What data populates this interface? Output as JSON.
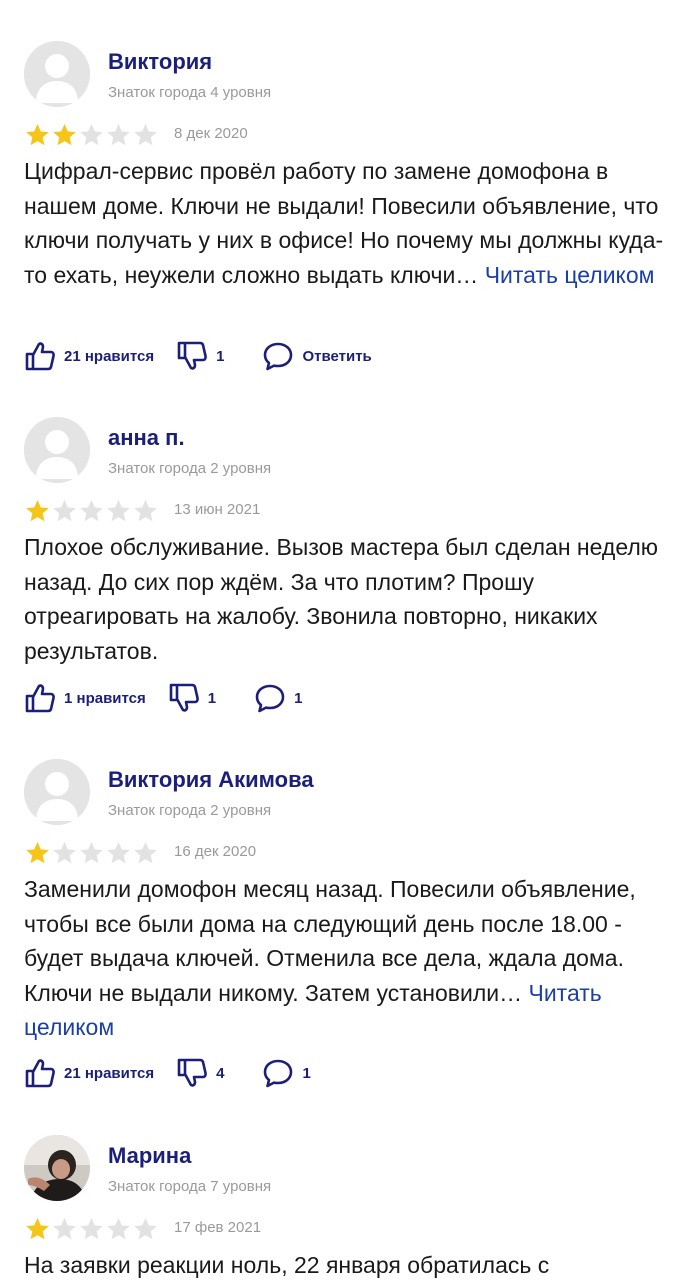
{
  "colors": {
    "author": "#1b1f7a",
    "link": "#1b3fa6",
    "muted": "#9a9a9a",
    "star_filled": "#f5c518",
    "star_empty": "#e2e2e2",
    "icon": "#1b1f7a"
  },
  "reviews": [
    {
      "author": "Виктория",
      "level": "Знаток города 4 уровня",
      "rating": 2,
      "date": "8 дек 2020",
      "text": "Цифрал-сервис провёл работу по замене домофона в нашем доме. Ключи не выдали! Повесили объявление, что ключи получать у них в офисе! Но почему мы должны куда-то ехать, неужели сложно выдать ключи…",
      "read_more": "Читать целиком",
      "likes": "21 нравится",
      "dislikes": "1",
      "comments": "Ответить"
    },
    {
      "author": "анна п.",
      "level": "Знаток города 2 уровня",
      "rating": 1,
      "date": "13 июн 2021",
      "text": "Плохое обслуживание. Вызов мастера был сделан неделю назад. До сих пор ждём. За что плотим? Прошу отреагировать на жалобу. Звонила повторно, никаких результатов.",
      "read_more": "",
      "likes": "1 нравится",
      "dislikes": "1",
      "comments": "1"
    },
    {
      "author": "Виктория Акимова",
      "level": "Знаток города 2 уровня",
      "rating": 1,
      "date": "16 дек 2020",
      "text": "Заменили домофон месяц назад. Повесили объявление, чтобы все были дома на следующий день после 18.00 - будет выдача ключей. Отменила все дела, ждала дома. Ключи не выдали никому. Затем установили…",
      "read_more": "Читать целиком",
      "likes": "21 нравится",
      "dislikes": "4",
      "comments": "1"
    },
    {
      "author": "Марина",
      "level": "Знаток города 7 уровня",
      "rating": 1,
      "date": "17 фев 2021",
      "text": "На заявки реакции ноль, 22 января обратилась с",
      "read_more": "",
      "likes": "",
      "dislikes": "",
      "comments": ""
    }
  ]
}
